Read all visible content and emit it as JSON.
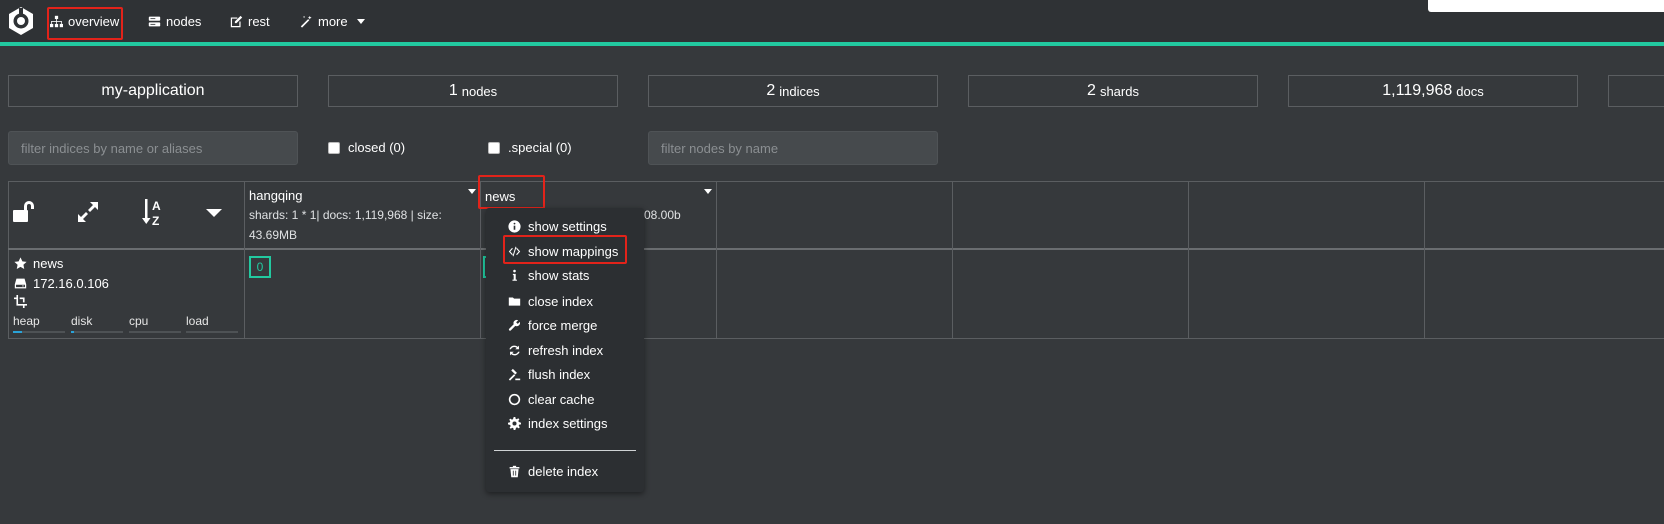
{
  "nav": {
    "items": [
      {
        "label": "overview",
        "icon": "sitemap-icon"
      },
      {
        "label": "nodes",
        "icon": "server-icon"
      },
      {
        "label": "rest",
        "icon": "edit-icon"
      },
      {
        "label": "more",
        "icon": "magic-icon"
      }
    ]
  },
  "stats": {
    "cluster_name": "my-application",
    "nodes": {
      "value": "1",
      "unit": "nodes"
    },
    "indices": {
      "value": "2",
      "unit": "indices"
    },
    "shards": {
      "value": "2",
      "unit": "shards"
    },
    "docs": {
      "value": "1,119,968",
      "unit": "docs"
    }
  },
  "filters": {
    "indices_placeholder": "filter indices by name or aliases",
    "closed_label": "closed (0)",
    "special_label": ".special (0)",
    "nodes_placeholder": "filter nodes by name"
  },
  "indices": [
    {
      "name": "hangqing",
      "meta_line1": "shards: 1 * 1| docs: 1,119,968 | size:",
      "meta_line2": "43.69MB"
    },
    {
      "name": "news",
      "meta_visible": "08.00b"
    }
  ],
  "node": {
    "name": "news",
    "ip": "172.16.0.106",
    "metrics": {
      "labels": [
        "heap",
        "disk",
        "cpu",
        "load"
      ],
      "levels_percent": [
        18,
        6,
        0,
        0
      ]
    }
  },
  "shard_label": "0",
  "menu": {
    "items": [
      {
        "label": "show settings",
        "icon": "info-circle-icon"
      },
      {
        "label": "show mappings",
        "icon": "code-icon"
      },
      {
        "label": "show stats",
        "icon": "info-icon"
      },
      {
        "label": "close index",
        "icon": "folder-icon"
      },
      {
        "label": "force merge",
        "icon": "wrench-icon"
      },
      {
        "label": "refresh index",
        "icon": "refresh-icon"
      },
      {
        "label": "flush index",
        "icon": "gavel-icon"
      },
      {
        "label": "clear cache",
        "icon": "circle-icon"
      },
      {
        "label": "index settings",
        "icon": "gear-icon"
      },
      {
        "label": "delete index",
        "icon": "trash-icon"
      }
    ]
  },
  "colors": {
    "accent": "#22c9a0",
    "highlight": "#e2231a",
    "background": "#36393c"
  }
}
